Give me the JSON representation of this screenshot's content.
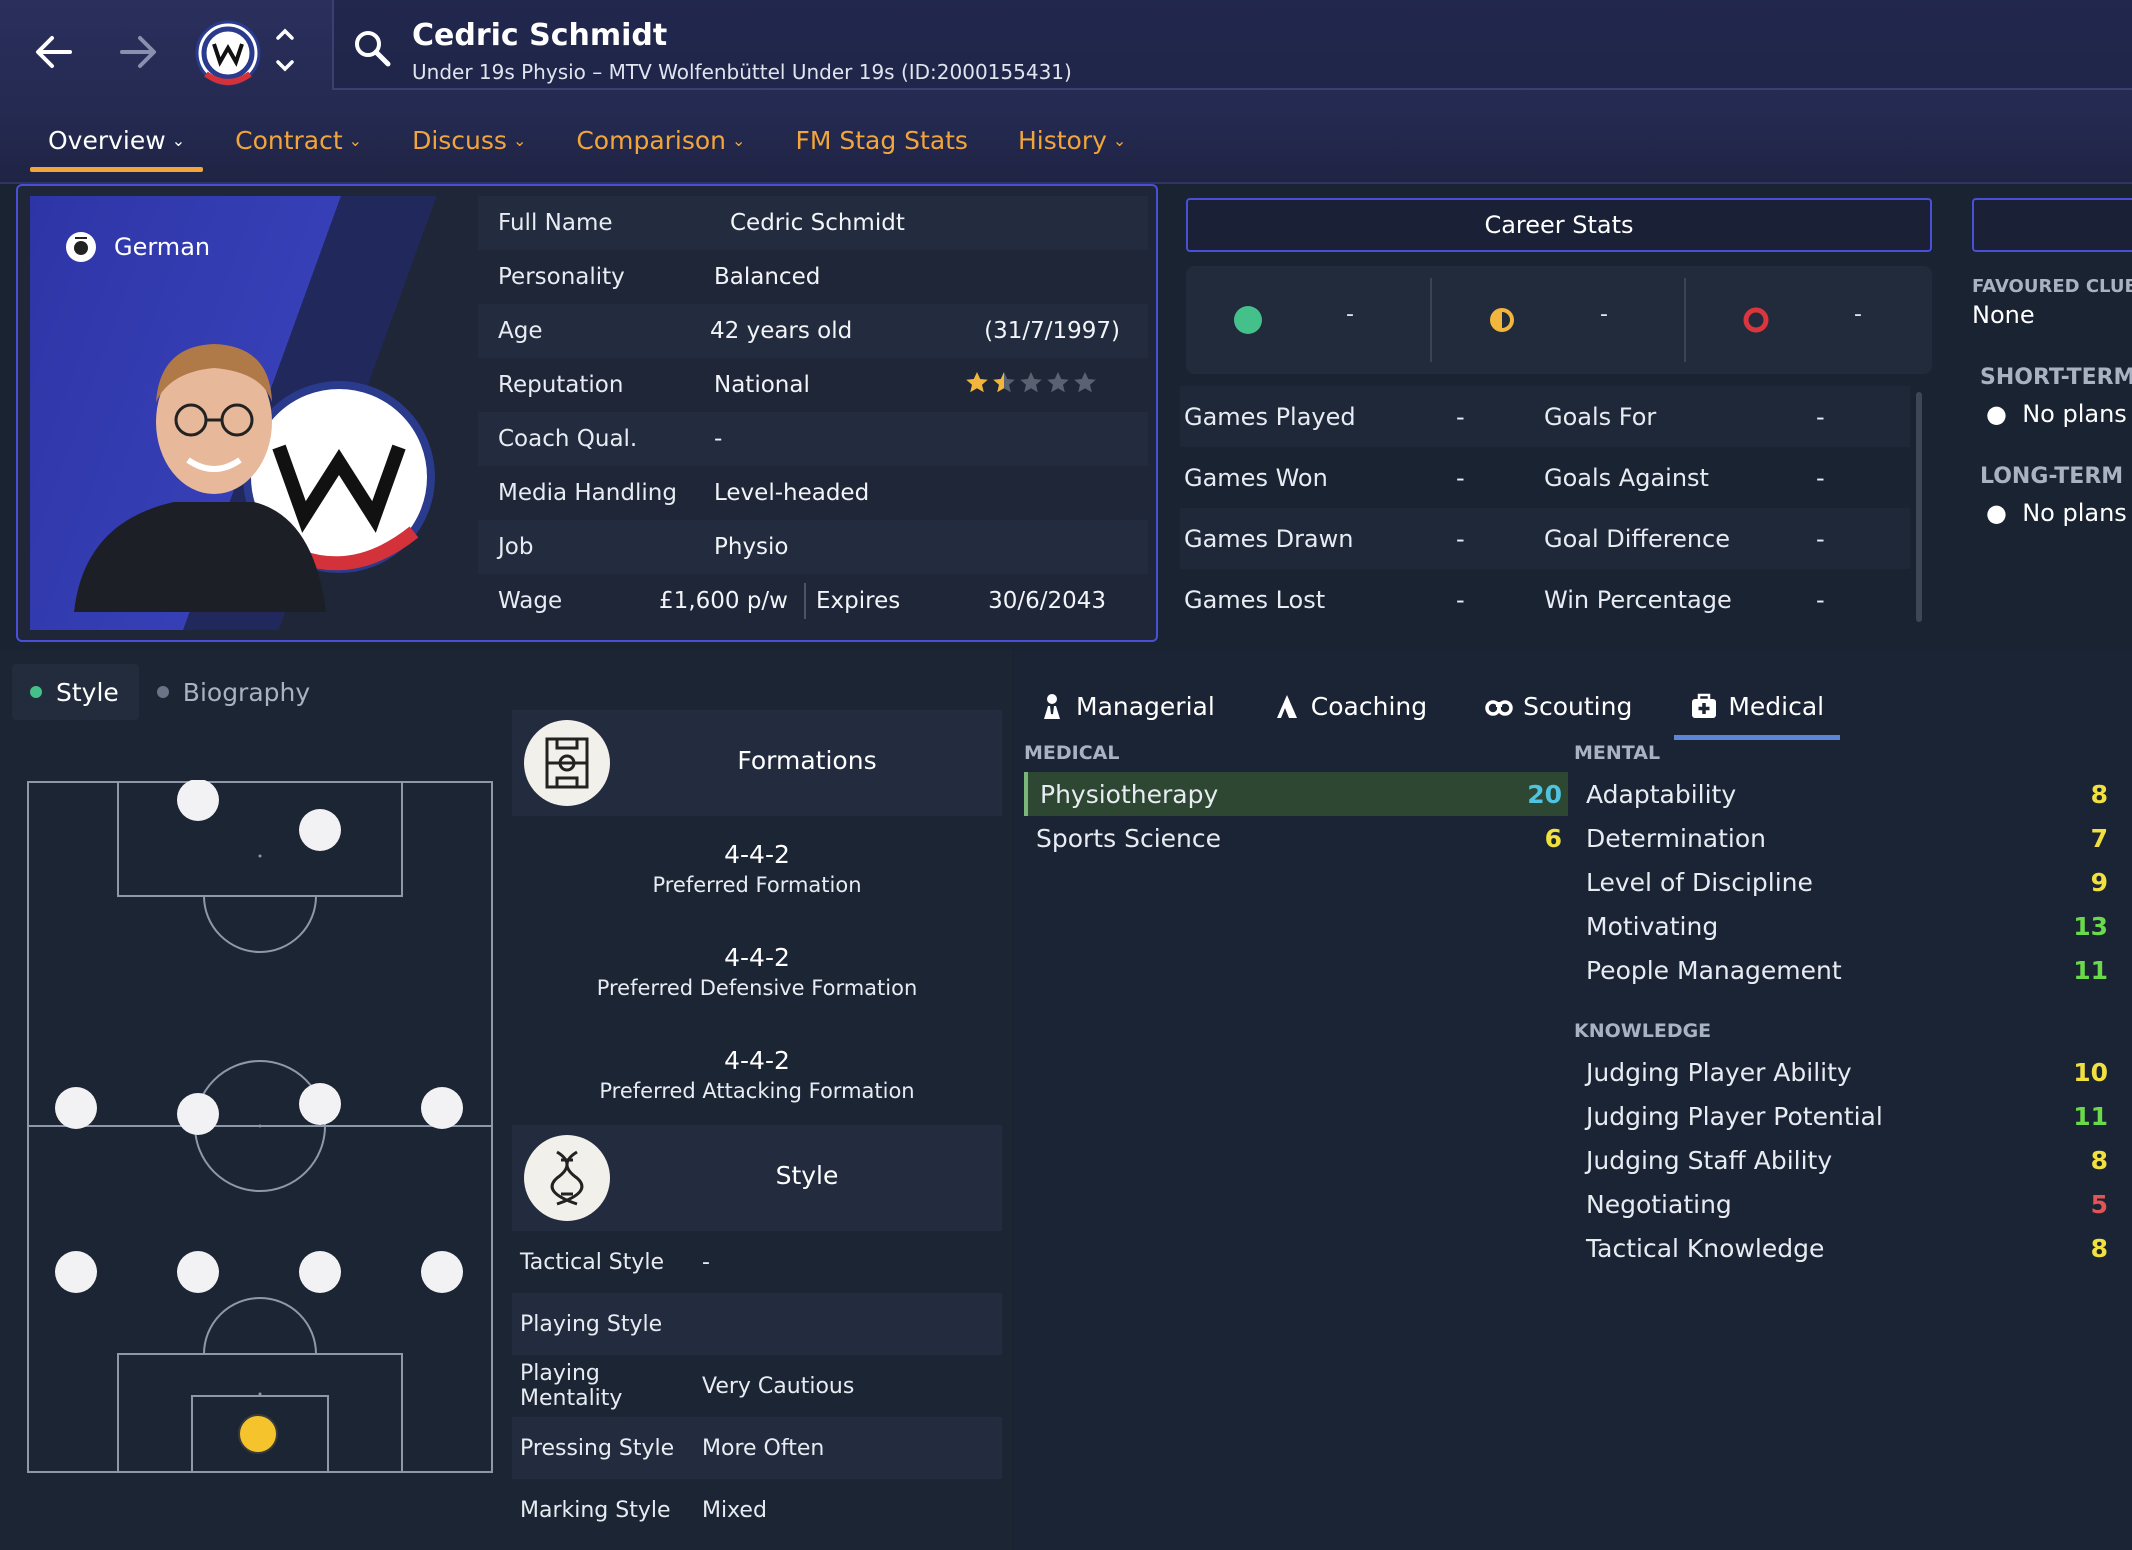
{
  "header": {
    "name": "Cedric Schmidt",
    "subtitle": "Under 19s Physio – MTV Wolfenbüttel Under 19s (ID:2000155431)"
  },
  "tabs": [
    {
      "label": "Overview"
    },
    {
      "label": "Contract"
    },
    {
      "label": "Discuss"
    },
    {
      "label": "Comparison"
    },
    {
      "label": "FM Stag Stats"
    },
    {
      "label": "History"
    }
  ],
  "profile": {
    "nationality": "German",
    "rows": [
      {
        "label": "Full Name",
        "value": "Cedric Schmidt"
      },
      {
        "label": "Personality",
        "value": "Balanced"
      },
      {
        "label": "Age",
        "value": "42 years old",
        "extra": "(31/7/1997)"
      },
      {
        "label": "Reputation",
        "value": "National"
      },
      {
        "label": "Coach Qual.",
        "value": "-"
      },
      {
        "label": "Media Handling",
        "value": "Level-headed"
      },
      {
        "label": "Job",
        "value": "Physio"
      }
    ],
    "reputation_stars": 1.5,
    "reputation_stars_max": 5,
    "wage_label": "Wage",
    "wage_value": "£1,600 p/w",
    "expires_label": "Expires",
    "expires_value": "30/6/2043"
  },
  "career": {
    "button_label": "Career Stats",
    "results": [
      {
        "icon": "win-dot",
        "value": "-"
      },
      {
        "icon": "draw-dot",
        "value": "-"
      },
      {
        "icon": "loss-dot",
        "value": "-"
      }
    ],
    "rows": [
      {
        "l1": "Games Played",
        "v1": "-",
        "l2": "Goals For",
        "v2": "-"
      },
      {
        "l1": "Games Won",
        "v1": "-",
        "l2": "Goals Against",
        "v2": "-"
      },
      {
        "l1": "Games Drawn",
        "v1": "-",
        "l2": "Goal Difference",
        "v2": "-"
      },
      {
        "l1": "Games Lost",
        "v1": "-",
        "l2": "Win Percentage",
        "v2": "-"
      }
    ]
  },
  "side": {
    "favoured_label": "FAVOURED CLUBS",
    "favoured_value": "None",
    "short_term_label": "SHORT-TERM PLANS",
    "short_term_value": "No plans f",
    "long_term_label": "LONG-TERM PLANS",
    "long_term_value": "No plans f"
  },
  "sub_tabs": [
    {
      "label": "Style"
    },
    {
      "label": "Biography"
    }
  ],
  "formations": {
    "title": "Formations",
    "items": [
      {
        "value": "4-4-2",
        "label": "Preferred Formation"
      },
      {
        "value": "4-4-2",
        "label": "Preferred Defensive Formation"
      },
      {
        "value": "4-4-2",
        "label": "Preferred Attacking Formation"
      }
    ],
    "style_title": "Style",
    "style_rows": [
      {
        "label": "Tactical Style",
        "value": "-"
      },
      {
        "label": "Playing Style",
        "value": ""
      },
      {
        "label": "Playing Mentality",
        "value": "Very Cautious"
      },
      {
        "label": "Pressing Style",
        "value": "More Often"
      },
      {
        "label": "Marking Style",
        "value": "Mixed"
      }
    ]
  },
  "attr_tabs": [
    {
      "label": "Managerial",
      "icon": "manager-icon"
    },
    {
      "label": "Coaching",
      "icon": "coaching-icon"
    },
    {
      "label": "Scouting",
      "icon": "binoculars-icon"
    },
    {
      "label": "Medical",
      "icon": "medical-kit-icon"
    }
  ],
  "attributes": {
    "medical_head": "MEDICAL",
    "medical": [
      {
        "name": "Physiotherapy",
        "value": "20"
      },
      {
        "name": "Sports Science",
        "value": "6"
      }
    ],
    "mental_head": "MENTAL",
    "mental": [
      {
        "name": "Adaptability",
        "value": "8"
      },
      {
        "name": "Determination",
        "value": "7"
      },
      {
        "name": "Level of Discipline",
        "value": "9"
      },
      {
        "name": "Motivating",
        "value": "13"
      },
      {
        "name": "People Management",
        "value": "11"
      }
    ],
    "knowledge_head": "KNOWLEDGE",
    "knowledge": [
      {
        "name": "Judging Player Ability",
        "value": "10"
      },
      {
        "name": "Judging Player Potential",
        "value": "11"
      },
      {
        "name": "Judging Staff Ability",
        "value": "8"
      },
      {
        "name": "Negotiating",
        "value": "5"
      },
      {
        "name": "Tactical Knowledge",
        "value": "8"
      }
    ]
  },
  "colors": {
    "accent_orange": "#f2a53a",
    "win": "#44c08a",
    "draw": "#f2b63c",
    "loss": "#d9363e",
    "attr_cyan": "#4fc3e0",
    "attr_yellow": "#f0e040",
    "attr_green": "#6ad94a",
    "attr_red": "#e05656"
  }
}
